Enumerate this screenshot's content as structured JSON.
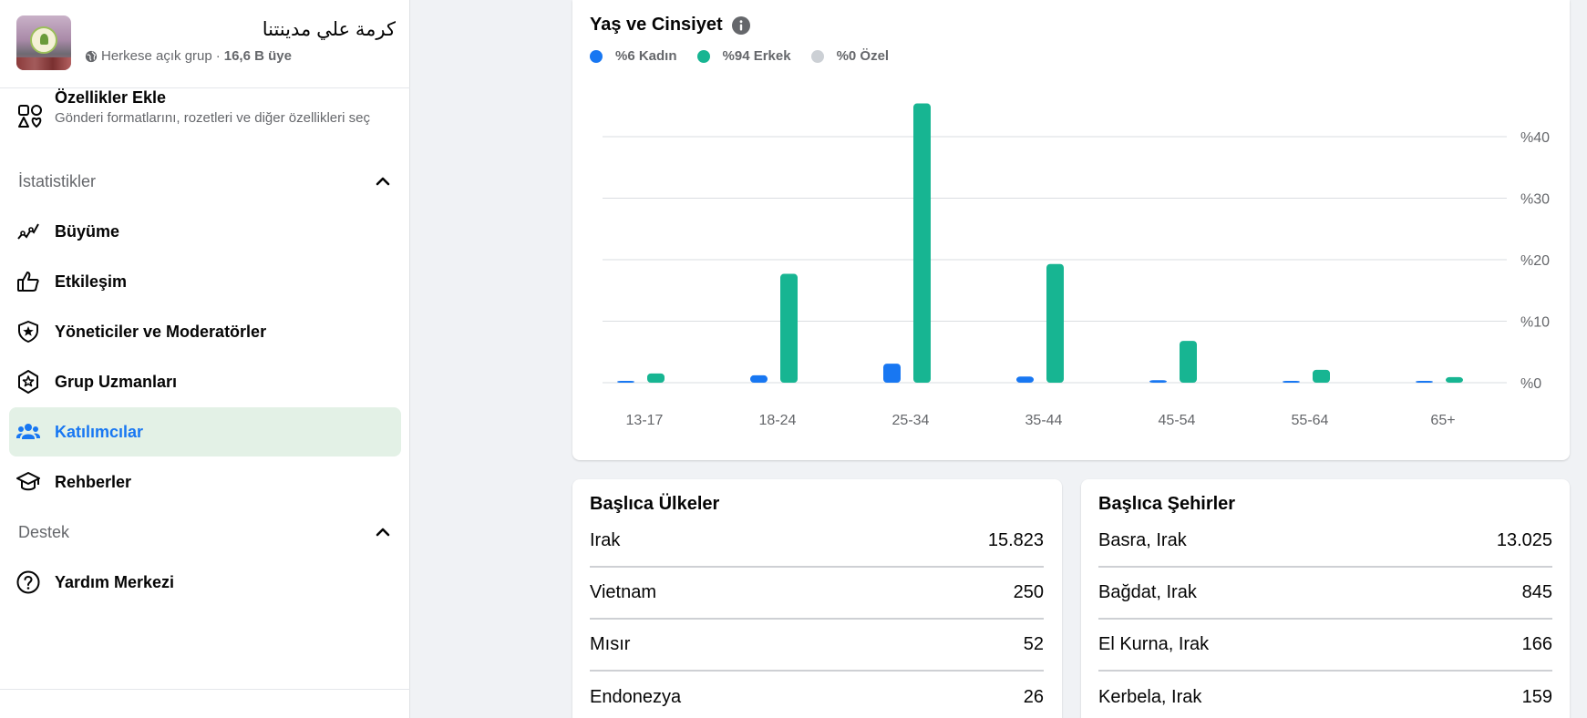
{
  "group": {
    "name": "كرمة علي مدينتنا",
    "privacy": "Herkese açık grup",
    "separator": " · ",
    "members": "16,6 B üye"
  },
  "features": {
    "title": "Özellikler Ekle",
    "description": "Gönderi formatlarını, rozetleri ve diğer özellikleri seç"
  },
  "sections": {
    "stats": "İstatistikler",
    "support": "Destek"
  },
  "nav": {
    "growth": "Büyüme",
    "engagement": "Etkileşim",
    "admins": "Yöneticiler ve Moderatörler",
    "experts": "Grup Uzmanları",
    "participants": "Katılımcılar",
    "guides": "Rehberler",
    "help": "Yardım Merkezi"
  },
  "chart_title": "Yaş ve Cinsiyet",
  "legend": {
    "female": "%6 Kadın",
    "male": "%94 Erkek",
    "custom": "%0 Özel"
  },
  "colors": {
    "female": "#1877f2",
    "male": "#17b592",
    "custom": "#ccd0d5",
    "active_bg": "#e3f1e6"
  },
  "chart_data": {
    "type": "bar",
    "categories": [
      "13-17",
      "18-24",
      "25-34",
      "35-44",
      "45-54",
      "55-64",
      "65+"
    ],
    "series": [
      {
        "name": "%6 Kadın",
        "values": [
          0.2,
          1.2,
          3.1,
          1.0,
          0.4,
          0.2,
          0.2
        ]
      },
      {
        "name": "%94 Erkek",
        "values": [
          1.5,
          17.7,
          45.4,
          19.3,
          6.8,
          2.1,
          0.9
        ]
      }
    ],
    "yticks": [
      "%0",
      "%10",
      "%20",
      "%30",
      "%40"
    ],
    "ylim": [
      0,
      45
    ],
    "grid": true
  },
  "countries": {
    "title": "Başlıca Ülkeler",
    "rows": [
      {
        "name": "Irak",
        "value": "15.823"
      },
      {
        "name": "Vietnam",
        "value": "250"
      },
      {
        "name": "Mısır",
        "value": "52"
      },
      {
        "name": "Endonezya",
        "value": "26"
      }
    ]
  },
  "cities": {
    "title": "Başlıca Şehirler",
    "rows": [
      {
        "name": "Basra, Irak",
        "value": "13.025"
      },
      {
        "name": "Bağdat, Irak",
        "value": "845"
      },
      {
        "name": "El Kurna, Irak",
        "value": "166"
      },
      {
        "name": "Kerbela, Irak",
        "value": "159"
      }
    ]
  }
}
